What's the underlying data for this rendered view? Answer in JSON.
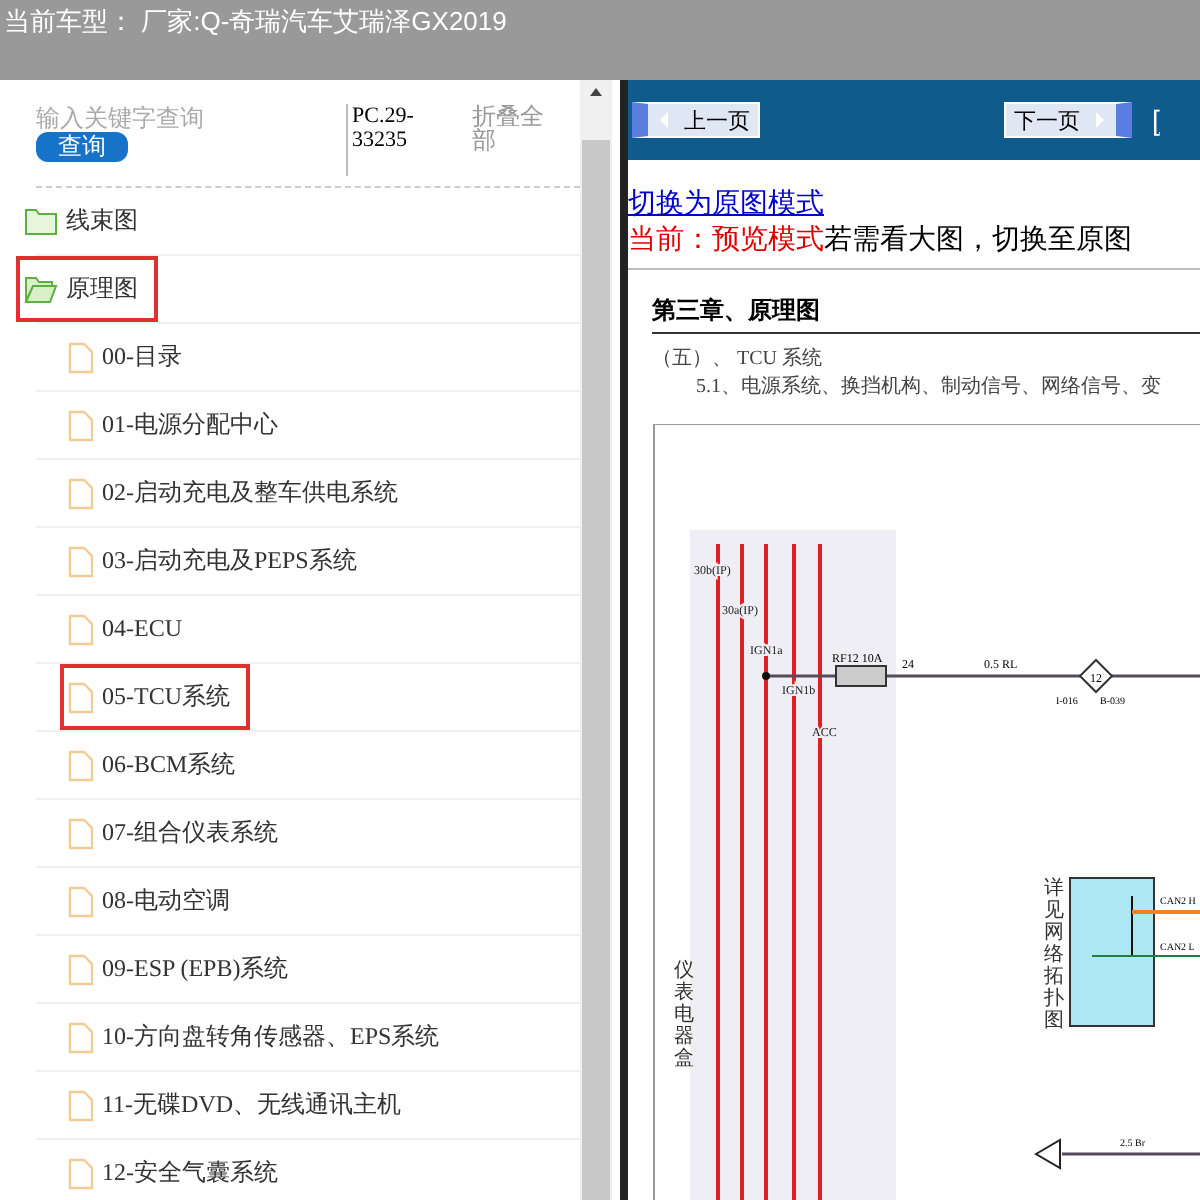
{
  "header": {
    "title": "当前车型： 厂家:Q-奇瑞汽车艾瑞泽GX2019"
  },
  "sidebar": {
    "search": {
      "placeholder": "输入关键字查询",
      "button": "查询"
    },
    "code": "PC.29-33235",
    "collapse_all": "折叠全部",
    "tree": [
      {
        "label": "线束图",
        "expanded": false,
        "highlighted": false
      },
      {
        "label": "原理图",
        "expanded": true,
        "highlighted": true,
        "children": [
          {
            "label": "00-目录",
            "highlighted": false
          },
          {
            "label": "01-电源分配中心",
            "highlighted": false
          },
          {
            "label": "02-启动充电及整车供电系统",
            "highlighted": false
          },
          {
            "label": "03-启动充电及PEPS系统",
            "highlighted": false
          },
          {
            "label": "04-ECU",
            "highlighted": false
          },
          {
            "label": "05-TCU系统",
            "highlighted": true
          },
          {
            "label": "06-BCM系统",
            "highlighted": false
          },
          {
            "label": "07-组合仪表系统",
            "highlighted": false
          },
          {
            "label": "08-电动空调",
            "highlighted": false
          },
          {
            "label": "09-ESP (EPB)系统",
            "highlighted": false
          },
          {
            "label": "10-方向盘转角传感器、EPS系统",
            "highlighted": false
          },
          {
            "label": "11-无碟DVD、无线通讯主机",
            "highlighted": false
          },
          {
            "label": "12-安全气囊系统",
            "highlighted": false
          }
        ]
      }
    ]
  },
  "viewer": {
    "prev_button": "上一页",
    "next_button": "下一页",
    "cut_link": "[",
    "mode_link": "切换为原图模式",
    "mode_current": "当前：预览模式",
    "mode_hint": "若需看大图，切换至原图",
    "document": {
      "chapter": "第三章、原理图",
      "section": "（五）、 TCU 系统",
      "subsection": "5.1、电源系统、换挡机构、制动信号、网络信号、变",
      "schematic": {
        "rails": [
          "30b(IP)",
          "30a(IP)",
          "IGN1a",
          "IGN1b",
          "ACC"
        ],
        "fuse": "RF12 10A",
        "pin": "24",
        "wire": "0.5 RL",
        "connector": "12",
        "connector_left": "I-016",
        "connector_right": "B-039",
        "box_label": "仪表电器盒",
        "network_label": "详见网络拓扑图",
        "can_high": "CAN2 H",
        "can_low": "CAN2 L",
        "ground_wire": "2.5 Br"
      }
    }
  }
}
